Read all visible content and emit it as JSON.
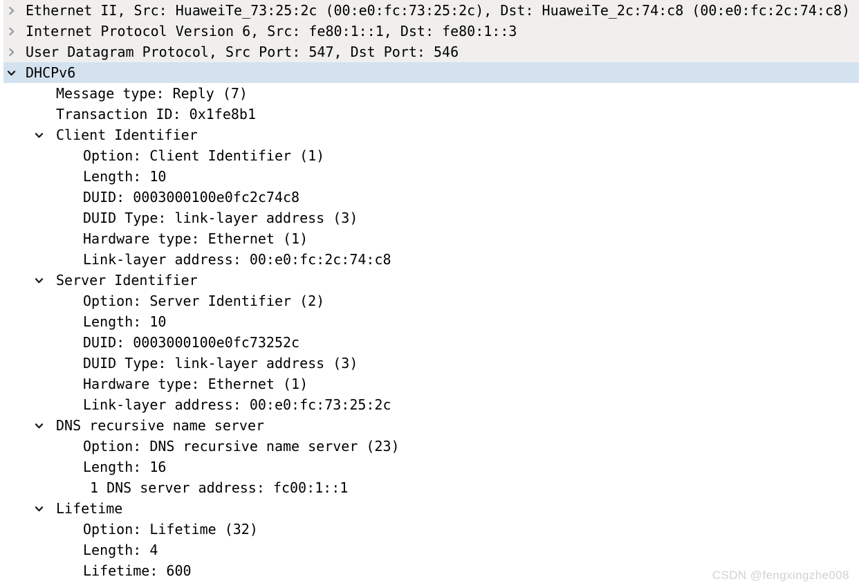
{
  "pane": {
    "name": "packet-details",
    "colors": {
      "background": "#ffffff",
      "collapsed_row_background": "#f0efed",
      "selected_row_background": "#d4e2f0",
      "text": "#000000",
      "collapsed_twisty": "#9b9b9b",
      "expanded_twisty": "#1a1a1a",
      "watermark": "#d2d2d2"
    }
  },
  "icons": {
    "collapsed": "chevron-right-icon",
    "expanded": "chevron-down-icon"
  },
  "rows": [
    {
      "id": "ethernet-ii",
      "text": "Ethernet II, Src: HuaweiTe_73:25:2c (00:e0:fc:73:25:2c), Dst: HuaweiTe_2c:74:c8 (00:e0:fc:2c:74:c8)",
      "twisty": "closed",
      "twisty_depth": 0,
      "indent": 0,
      "background": "gray"
    },
    {
      "id": "internet-protocol-version-6",
      "text": "Internet Protocol Version 6, Src: fe80:1::1, Dst: fe80:1::3",
      "twisty": "closed",
      "twisty_depth": 0,
      "indent": 0,
      "background": "gray"
    },
    {
      "id": "user-datagram-protocol",
      "text": "User Datagram Protocol, Src Port: 547, Dst Port: 546",
      "twisty": "closed",
      "twisty_depth": 0,
      "indent": 0,
      "background": "gray"
    },
    {
      "id": "dhcpv6",
      "text": "DHCPv6",
      "twisty": "open",
      "twisty_depth": 0,
      "indent": 0,
      "background": "select"
    },
    {
      "id": "message-type",
      "text": "Message type: Reply (7)",
      "twisty": "none",
      "twisty_depth": 0,
      "indent": 1,
      "background": "none"
    },
    {
      "id": "transaction-id",
      "text": "Transaction ID: 0x1fe8b1",
      "twisty": "none",
      "twisty_depth": 0,
      "indent": 1,
      "background": "none"
    },
    {
      "id": "client-identifier",
      "text": "Client Identifier",
      "twisty": "open",
      "twisty_depth": 1,
      "indent": 1,
      "background": "none"
    },
    {
      "id": "client-identifier-option",
      "text": "Option: Client Identifier (1)",
      "twisty": "none",
      "twisty_depth": 0,
      "indent": 2,
      "background": "none"
    },
    {
      "id": "client-identifier-length",
      "text": "Length: 10",
      "twisty": "none",
      "twisty_depth": 0,
      "indent": 2,
      "background": "none"
    },
    {
      "id": "client-identifier-duid",
      "text": "DUID: 0003000100e0fc2c74c8",
      "twisty": "none",
      "twisty_depth": 0,
      "indent": 2,
      "background": "none"
    },
    {
      "id": "client-identifier-duid-type",
      "text": "DUID Type: link-layer address (3)",
      "twisty": "none",
      "twisty_depth": 0,
      "indent": 2,
      "background": "none"
    },
    {
      "id": "client-identifier-hardware-type",
      "text": "Hardware type: Ethernet (1)",
      "twisty": "none",
      "twisty_depth": 0,
      "indent": 2,
      "background": "none"
    },
    {
      "id": "client-identifier-link-layer-address",
      "text": "Link-layer address: 00:e0:fc:2c:74:c8",
      "twisty": "none",
      "twisty_depth": 0,
      "indent": 2,
      "background": "none"
    },
    {
      "id": "server-identifier",
      "text": "Server Identifier",
      "twisty": "open",
      "twisty_depth": 1,
      "indent": 1,
      "background": "none"
    },
    {
      "id": "server-identifier-option",
      "text": "Option: Server Identifier (2)",
      "twisty": "none",
      "twisty_depth": 0,
      "indent": 2,
      "background": "none"
    },
    {
      "id": "server-identifier-length",
      "text": "Length: 10",
      "twisty": "none",
      "twisty_depth": 0,
      "indent": 2,
      "background": "none"
    },
    {
      "id": "server-identifier-duid",
      "text": "DUID: 0003000100e0fc73252c",
      "twisty": "none",
      "twisty_depth": 0,
      "indent": 2,
      "background": "none"
    },
    {
      "id": "server-identifier-duid-type",
      "text": "DUID Type: link-layer address (3)",
      "twisty": "none",
      "twisty_depth": 0,
      "indent": 2,
      "background": "none"
    },
    {
      "id": "server-identifier-hardware-type",
      "text": "Hardware type: Ethernet (1)",
      "twisty": "none",
      "twisty_depth": 0,
      "indent": 2,
      "background": "none"
    },
    {
      "id": "server-identifier-link-layer-address",
      "text": "Link-layer address: 00:e0:fc:73:25:2c",
      "twisty": "none",
      "twisty_depth": 0,
      "indent": 2,
      "background": "none"
    },
    {
      "id": "dns-recursive-name-server",
      "text": "DNS recursive name server",
      "twisty": "open",
      "twisty_depth": 1,
      "indent": 1,
      "background": "none"
    },
    {
      "id": "dns-recursive-name-server-option",
      "text": "Option: DNS recursive name server (23)",
      "twisty": "none",
      "twisty_depth": 0,
      "indent": 2,
      "background": "none"
    },
    {
      "id": "dns-recursive-name-server-length",
      "text": "Length: 16",
      "twisty": "none",
      "twisty_depth": 0,
      "indent": 2,
      "background": "none"
    },
    {
      "id": "dns-server-address",
      "text": "1 DNS server address: fc00:1::1",
      "twisty": "none",
      "twisty_depth": 0,
      "indent": 3,
      "background": "none"
    },
    {
      "id": "lifetime",
      "text": "Lifetime",
      "twisty": "open",
      "twisty_depth": 1,
      "indent": 1,
      "background": "none"
    },
    {
      "id": "lifetime-option",
      "text": "Option: Lifetime (32)",
      "twisty": "none",
      "twisty_depth": 0,
      "indent": 2,
      "background": "none"
    },
    {
      "id": "lifetime-length",
      "text": "Length: 4",
      "twisty": "none",
      "twisty_depth": 0,
      "indent": 2,
      "background": "none"
    },
    {
      "id": "lifetime-value",
      "text": "Lifetime: 600",
      "twisty": "none",
      "twisty_depth": 0,
      "indent": 2,
      "background": "none"
    }
  ],
  "watermark": {
    "text": "CSDN @fengxingzhe008"
  }
}
